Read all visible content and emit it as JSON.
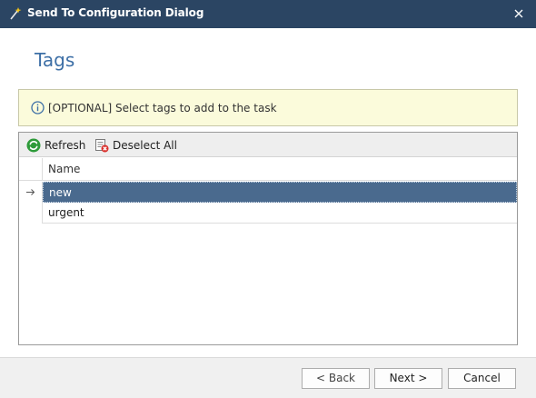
{
  "window": {
    "title": "Send To Configuration Dialog"
  },
  "page": {
    "heading": "Tags"
  },
  "info": {
    "text": "[OPTIONAL] Select tags to add to the task"
  },
  "toolbar": {
    "refresh_label": "Refresh",
    "deselect_label": "Deselect All"
  },
  "grid": {
    "column_header": "Name",
    "rows": [
      {
        "name": "new",
        "selected": true
      },
      {
        "name": "urgent",
        "selected": false
      }
    ]
  },
  "buttons": {
    "back": "< Back",
    "next": "Next >",
    "cancel": "Cancel"
  },
  "colors": {
    "titlebar": "#2b4563",
    "heading": "#3d6fa6",
    "selection": "#4a6a8e",
    "info_bg": "#fbfbdb"
  }
}
